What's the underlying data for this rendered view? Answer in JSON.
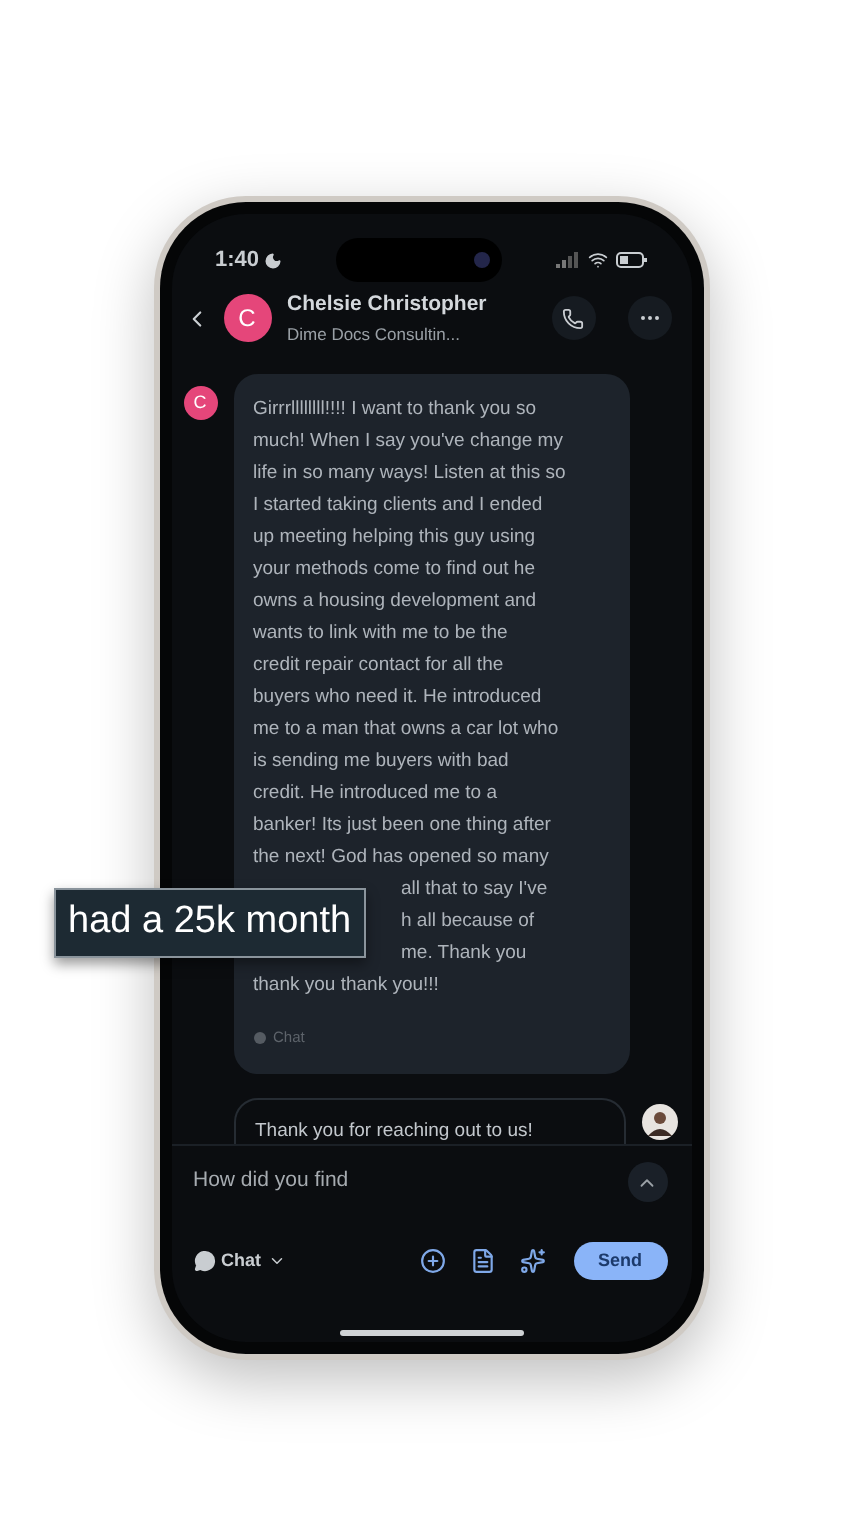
{
  "status_bar": {
    "time": "1:40"
  },
  "header": {
    "name": "Chelsie Christopher",
    "subtitle": "Dime Docs Consultin...",
    "avatar_letter": "C"
  },
  "messages": [
    {
      "kind": "incoming",
      "avatar_letter": "C",
      "lines": [
        {
          "kind": "text",
          "text": "Girrrllllllll!!!! I want to thank you so"
        },
        {
          "kind": "text",
          "text": "much! When I say you've change my"
        },
        {
          "kind": "text",
          "text": "life in so many ways! Listen at this so"
        },
        {
          "kind": "text",
          "text": "I started taking clients and I ended"
        },
        {
          "kind": "text",
          "text": "up meeting helping this guy using"
        },
        {
          "kind": "text",
          "text": "your methods come to find out he"
        },
        {
          "kind": "text",
          "text": "owns a housing development and"
        },
        {
          "kind": "text",
          "text": "wants to link with me to be the"
        },
        {
          "kind": "text",
          "text": "credit repair contact for all the"
        },
        {
          "kind": "text",
          "text": "buyers who need it. He introduced"
        },
        {
          "kind": "text",
          "text": "me to a man that owns a car lot who"
        },
        {
          "kind": "text",
          "text": "is sending me buyers with bad"
        },
        {
          "kind": "text",
          "text": "credit. He introduced me to a"
        },
        {
          "kind": "text",
          "text": "banker! Its just been one thing after"
        },
        {
          "kind": "text",
          "text": "the next! God has opened so many"
        },
        {
          "kind": "covered",
          "text": "all that to say I've"
        },
        {
          "kind": "covered",
          "text": "h all because of"
        },
        {
          "kind": "covered",
          "text": "me. Thank you"
        },
        {
          "kind": "text",
          "text": "thank you thank you!!!"
        }
      ],
      "channel": "Chat"
    },
    {
      "kind": "outgoing",
      "lines": [
        {
          "kind": "text",
          "text": "Thank you for reaching out to us!"
        }
      ]
    }
  ],
  "composer": {
    "value": "How did you find",
    "channel": "Chat",
    "send": "Send"
  },
  "caption": "had a 25k month"
}
